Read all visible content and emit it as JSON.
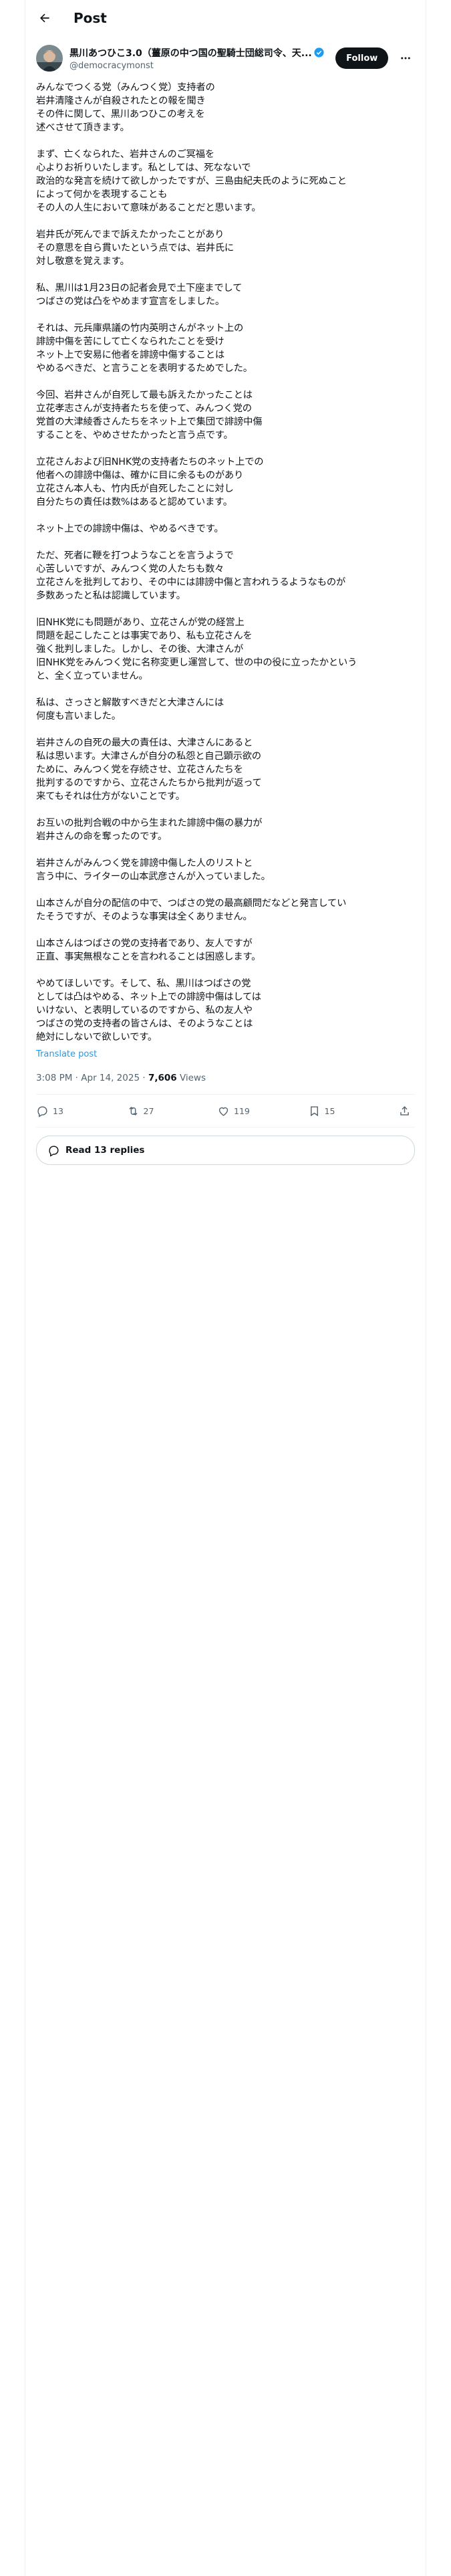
{
  "header": {
    "title": "Post"
  },
  "author": {
    "display_name": "黒川あつひこ3.0（薑原の中つ国の聖騎士団総司令、天...",
    "handle": "@democracymonst",
    "follow_label": "Follow"
  },
  "post": {
    "paragraphs": [
      "みんなでつくる党（みんつく党）支持者の\n岩井清隆さんが自殺されたとの報を聞き\nその件に関して、黒川あつひこの考えを\n述べさせて頂きます。",
      "まず、亡くなられた、岩井さんのご冥福を\n心よりお祈りいたします。私としては、死なないで\n政治的な発言を続けて欲しかったですが、三島由紀夫氏のように死ぬこと\nによって何かを表現することも\nその人の人生において意味があることだと思います。",
      "岩井氏が死んでまで訴えたかったことがあり\nその意思を自ら貫いたという点では、岩井氏に\n対し敬意を覚えます。",
      "私、黒川は1月23日の記者会見で土下座までして\nつばさの党は凸をやめます宣言をしました。",
      "それは、元兵庫県議の竹内英明さんがネット上の\n誹謗中傷を苦にして亡くなられたことを受け\nネット上で安易に他者を誹謗中傷することは\nやめるべきだ、と言うことを表明するためでした。",
      "今回、岩井さんが自死して最も訴えたかったことは\n立花孝志さんが支持者たちを使って、みんつく党の\n党首の大津綾香さんたちをネット上で集団で誹謗中傷\nすることを、やめさせたかったと言う点です。",
      "立花さんおよび旧NHK党の支持者たちのネット上での\n他者への誹謗中傷は、確かに目に余るものがあり\n立花さん本人も、竹内氏が自死したことに対し\n自分たちの責任は数%はあると認めています。",
      "ネット上での誹謗中傷は、やめるべきです。",
      "ただ、死者に鞭を打つようなことを言うようで\n心苦しいですが、みんつく党の人たちも数々\n立花さんを批判しており、その中には誹謗中傷と言われうるようなものが\n多数あったと私は認識しています。",
      "旧NHK党にも問題があり、立花さんが党の経営上\n問題を起こしたことは事実であり、私も立花さんを\n強く批判しました。しかし、その後、大津さんが\n旧NHK党をみんつく党に名称変更し運営して、世の中の役に立ったかという\nと、全く立っていません。",
      "私は、さっさと解散すべきだと大津さんには\n何度も言いました。",
      "岩井さんの自死の最大の責任は、大津さんにあると\n私は思います。大津さんが自分の私怨と自己顕示欲の\nために、みんつく党を存続させ、立花さんたちを\n批判するのですから、立花さんたちから批判が返って\n来てもそれは仕方がないことです。",
      "お互いの批判合戦の中から生まれた誹謗中傷の暴力が\n岩井さんの命を奪ったのです。",
      "岩井さんがみんつく党を誹謗中傷した人のリストと\n言う中に、ライターの山本武彦さんが入っていました。",
      "山本さんが自分の配信の中で、つばさの党の最高顧問だなどと発言してい\nたそうですが、そのような事実は全くありません。",
      "山本さんはつばさの党の支持者であり、友人ですが\n正直、事実無根なことを言われることは困惑します。",
      "やめてほしいです。そして、私、黒川はつばさの党\nとしては凸はやめる、ネット上での誹謗中傷はしては\nいけない、と表明しているのですから、私の友人や\nつばさの党の支持者の皆さんは、そのようなことは\n絶対にしないで欲しいです。"
    ],
    "translate_label": "Translate post",
    "time": "3:08 PM · Apr 14, 2025",
    "views_count": "7,606",
    "views_label": "Views"
  },
  "actions": {
    "replies": "13",
    "reposts": "27",
    "likes": "119",
    "bookmarks": "15"
  },
  "read_replies_label": "Read 13 replies",
  "colors": {
    "accent": "#1d9bf0",
    "text": "#0f1419",
    "secondary": "#536471",
    "border": "#eff3f4"
  }
}
